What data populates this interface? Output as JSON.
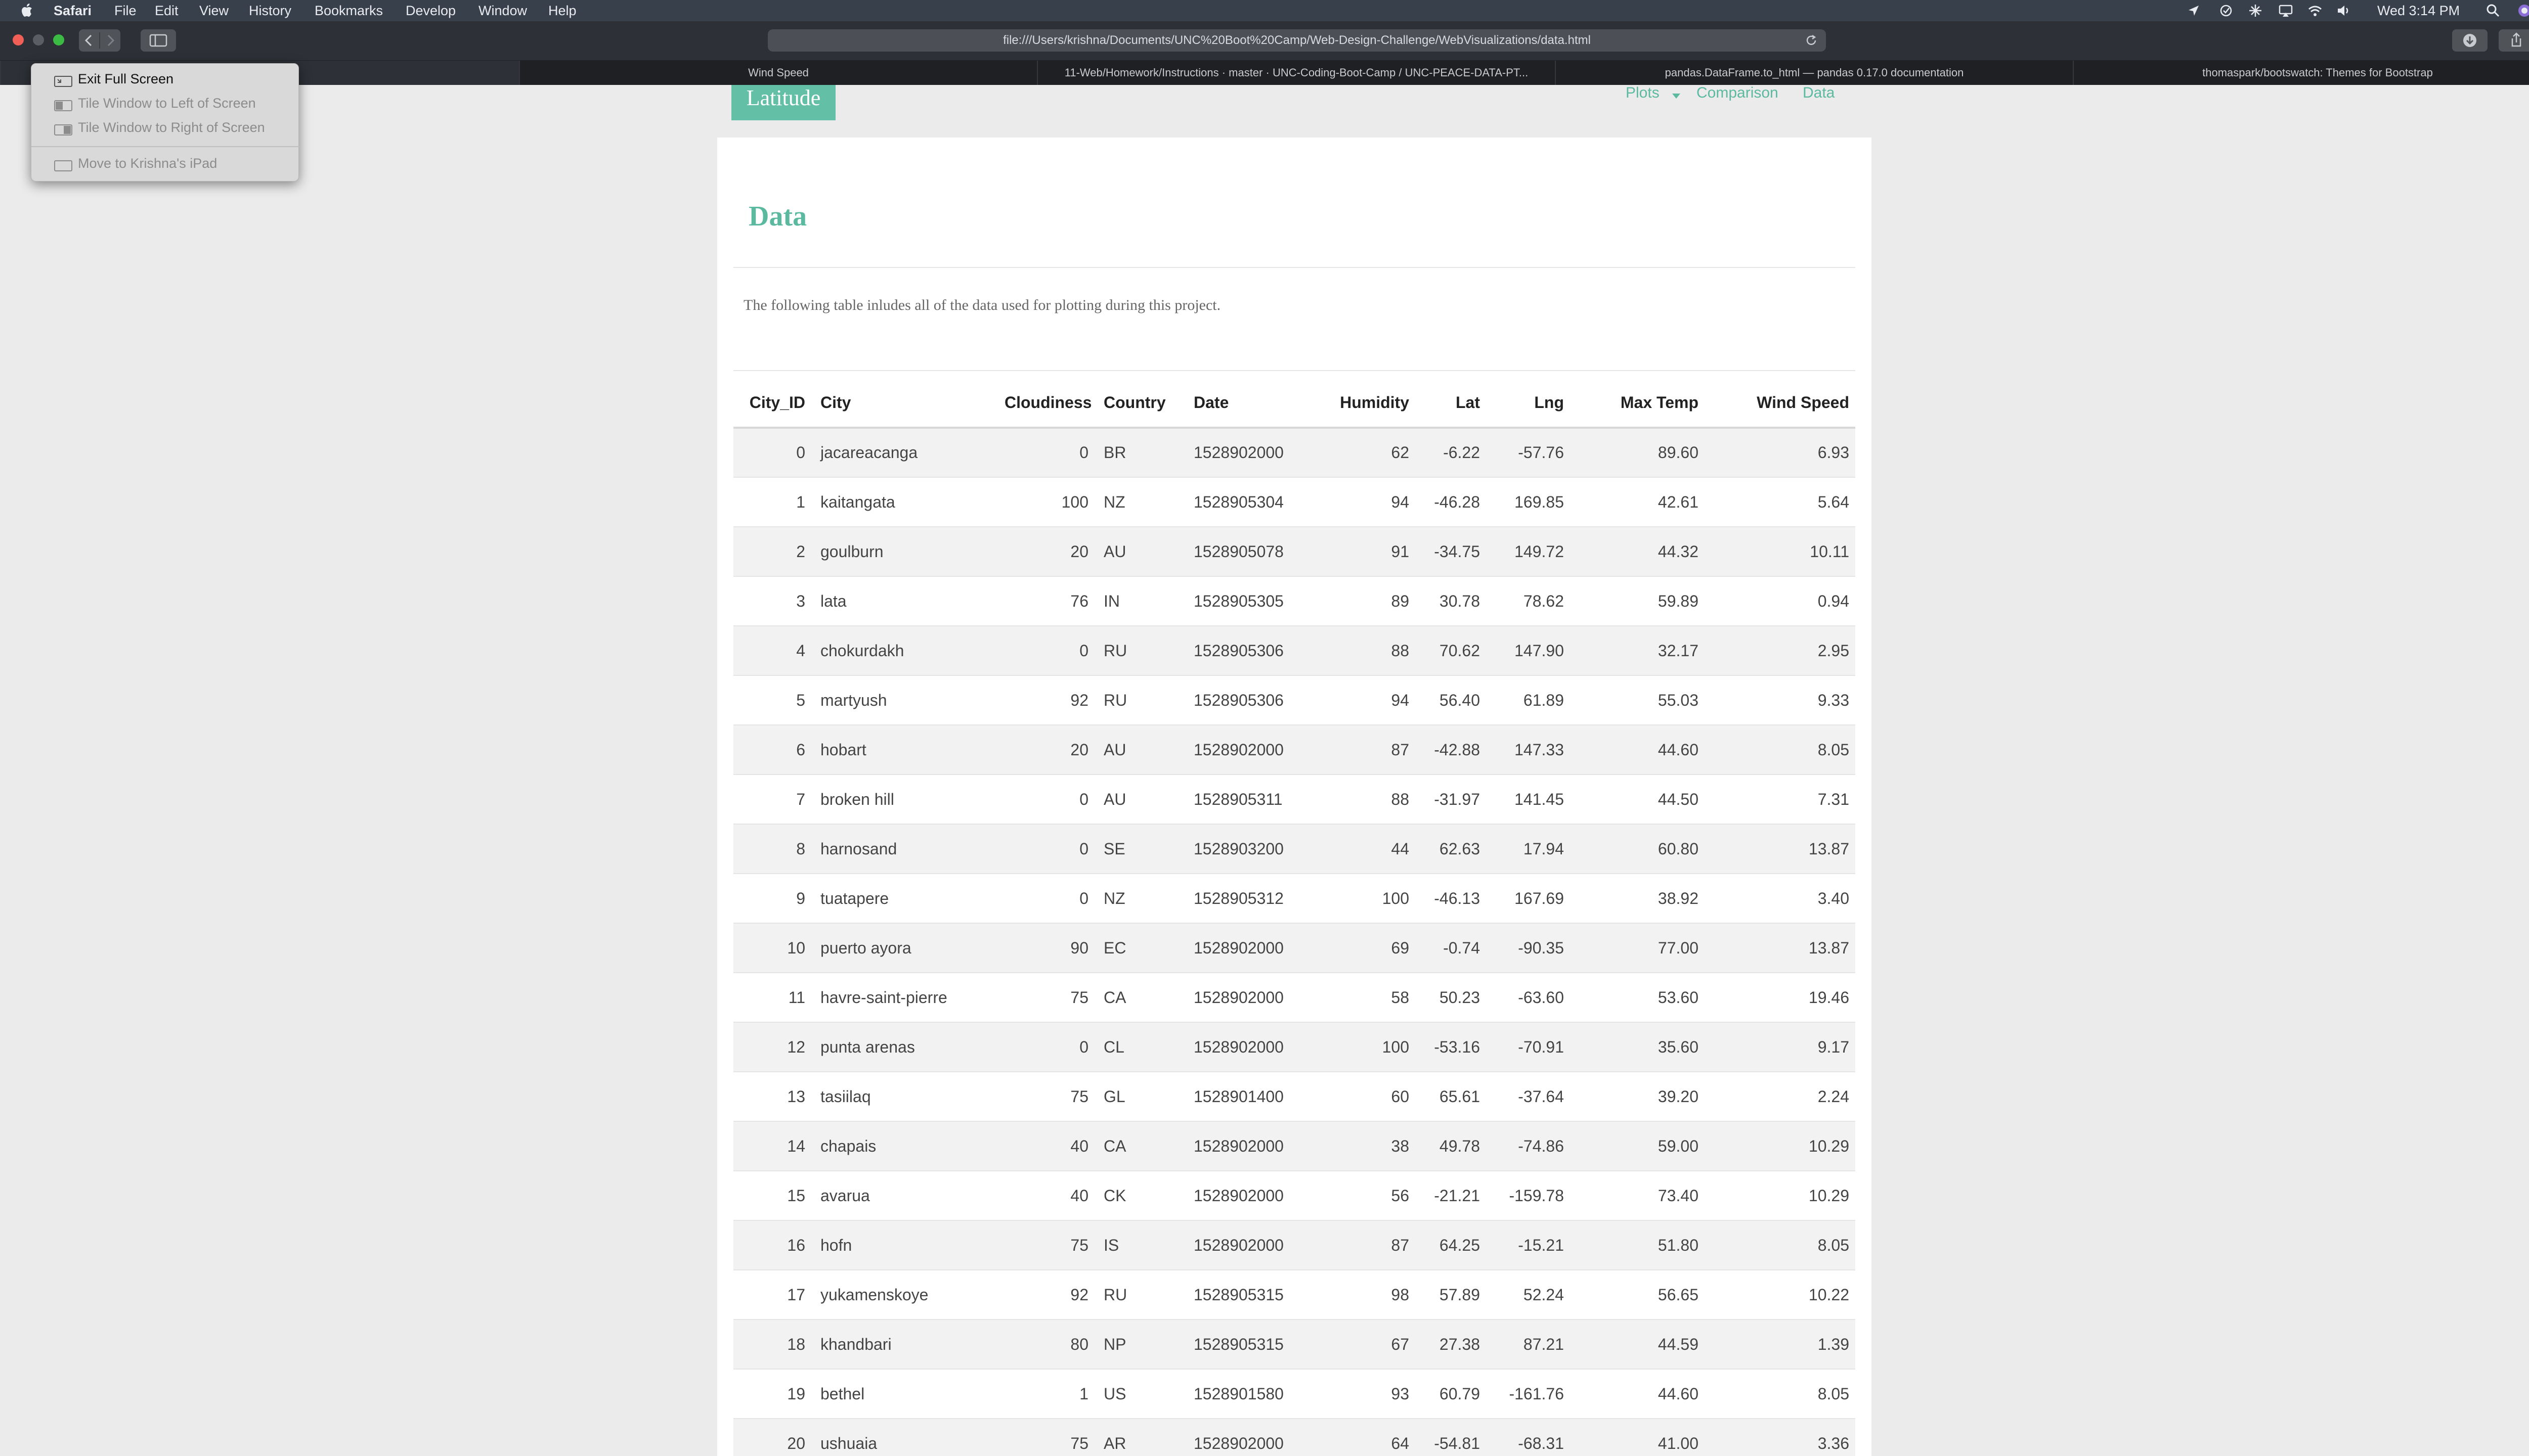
{
  "menubar": {
    "app_name": "Safari",
    "items": [
      "File",
      "Edit",
      "View",
      "History",
      "Bookmarks",
      "Develop",
      "Window",
      "Help"
    ],
    "clock": "Wed 3:14 PM"
  },
  "toolbar": {
    "address": "file:///Users/krishna/Documents/UNC%20Boot%20Camp/Web-Design-Challenge/WebVisualizations/data.html"
  },
  "tabs": [
    {
      "label": ""
    },
    {
      "label": "Wind Speed"
    },
    {
      "label": "11-Web/Homework/Instructions · master · UNC-Coding-Boot-Camp / UNC-PEACE-DATA-PT..."
    },
    {
      "label": "pandas.DataFrame.to_html — pandas 0.17.0 documentation"
    },
    {
      "label": "thomaspark/bootswatch: Themes for Bootstrap"
    }
  ],
  "context_menu": {
    "items": [
      {
        "label": "Exit Full Screen",
        "enabled": true
      },
      {
        "label": "Tile Window to Left of Screen",
        "enabled": false
      },
      {
        "label": "Tile Window to Right of Screen",
        "enabled": false
      },
      {
        "label": "Move to Krishna's iPad",
        "enabled": false
      }
    ]
  },
  "site": {
    "brand": "Latitude",
    "nav": {
      "plots": "Plots",
      "comparison": "Comparison",
      "data": "Data"
    }
  },
  "page": {
    "title": "Data",
    "intro": "The following table inludes all of the data used for plotting during this project."
  },
  "table": {
    "columns": [
      "City_ID",
      "City",
      "Cloudiness",
      "Country",
      "Date",
      "Humidity",
      "Lat",
      "Lng",
      "Max Temp",
      "Wind Speed"
    ],
    "rows": [
      [
        "0",
        "jacareacanga",
        "0",
        "BR",
        "1528902000",
        "62",
        "-6.22",
        "-57.76",
        "89.60",
        "6.93"
      ],
      [
        "1",
        "kaitangata",
        "100",
        "NZ",
        "1528905304",
        "94",
        "-46.28",
        "169.85",
        "42.61",
        "5.64"
      ],
      [
        "2",
        "goulburn",
        "20",
        "AU",
        "1528905078",
        "91",
        "-34.75",
        "149.72",
        "44.32",
        "10.11"
      ],
      [
        "3",
        "lata",
        "76",
        "IN",
        "1528905305",
        "89",
        "30.78",
        "78.62",
        "59.89",
        "0.94"
      ],
      [
        "4",
        "chokurdakh",
        "0",
        "RU",
        "1528905306",
        "88",
        "70.62",
        "147.90",
        "32.17",
        "2.95"
      ],
      [
        "5",
        "martyush",
        "92",
        "RU",
        "1528905306",
        "94",
        "56.40",
        "61.89",
        "55.03",
        "9.33"
      ],
      [
        "6",
        "hobart",
        "20",
        "AU",
        "1528902000",
        "87",
        "-42.88",
        "147.33",
        "44.60",
        "8.05"
      ],
      [
        "7",
        "broken hill",
        "0",
        "AU",
        "1528905311",
        "88",
        "-31.97",
        "141.45",
        "44.50",
        "7.31"
      ],
      [
        "8",
        "harnosand",
        "0",
        "SE",
        "1528903200",
        "44",
        "62.63",
        "17.94",
        "60.80",
        "13.87"
      ],
      [
        "9",
        "tuatapere",
        "0",
        "NZ",
        "1528905312",
        "100",
        "-46.13",
        "167.69",
        "38.92",
        "3.40"
      ],
      [
        "10",
        "puerto ayora",
        "90",
        "EC",
        "1528902000",
        "69",
        "-0.74",
        "-90.35",
        "77.00",
        "13.87"
      ],
      [
        "11",
        "havre-saint-pierre",
        "75",
        "CA",
        "1528902000",
        "58",
        "50.23",
        "-63.60",
        "53.60",
        "19.46"
      ],
      [
        "12",
        "punta arenas",
        "0",
        "CL",
        "1528902000",
        "100",
        "-53.16",
        "-70.91",
        "35.60",
        "9.17"
      ],
      [
        "13",
        "tasiilaq",
        "75",
        "GL",
        "1528901400",
        "60",
        "65.61",
        "-37.64",
        "39.20",
        "2.24"
      ],
      [
        "14",
        "chapais",
        "40",
        "CA",
        "1528902000",
        "38",
        "49.78",
        "-74.86",
        "59.00",
        "10.29"
      ],
      [
        "15",
        "avarua",
        "40",
        "CK",
        "1528902000",
        "56",
        "-21.21",
        "-159.78",
        "73.40",
        "10.29"
      ],
      [
        "16",
        "hofn",
        "75",
        "IS",
        "1528902000",
        "87",
        "64.25",
        "-15.21",
        "51.80",
        "8.05"
      ],
      [
        "17",
        "yukamenskoye",
        "92",
        "RU",
        "1528905315",
        "98",
        "57.89",
        "52.24",
        "56.65",
        "10.22"
      ],
      [
        "18",
        "khandbari",
        "80",
        "NP",
        "1528905315",
        "67",
        "27.38",
        "87.21",
        "44.59",
        "1.39"
      ],
      [
        "19",
        "bethel",
        "1",
        "US",
        "1528901580",
        "93",
        "60.79",
        "-161.76",
        "44.60",
        "8.05"
      ],
      [
        "20",
        "ushuaia",
        "75",
        "AR",
        "1528902000",
        "64",
        "-54.81",
        "-68.31",
        "41.00",
        "3.36"
      ]
    ]
  },
  "colors": {
    "accent": "#5bb99f",
    "brand_bg": "#64bfa7",
    "menubar_bg": "#38404c",
    "toolbar_bg": "#2d3036",
    "tabbar_bg": "#1e2024"
  },
  "icons": {
    "apple": "apple-icon",
    "location": "location-arrow-icon",
    "wifi": "wifi-icon",
    "volume": "volume-icon",
    "search": "spotlight-search-icon",
    "reload": "reload-icon",
    "download": "download-icon",
    "share": "share-icon",
    "tabs": "tab-overview-icon"
  }
}
